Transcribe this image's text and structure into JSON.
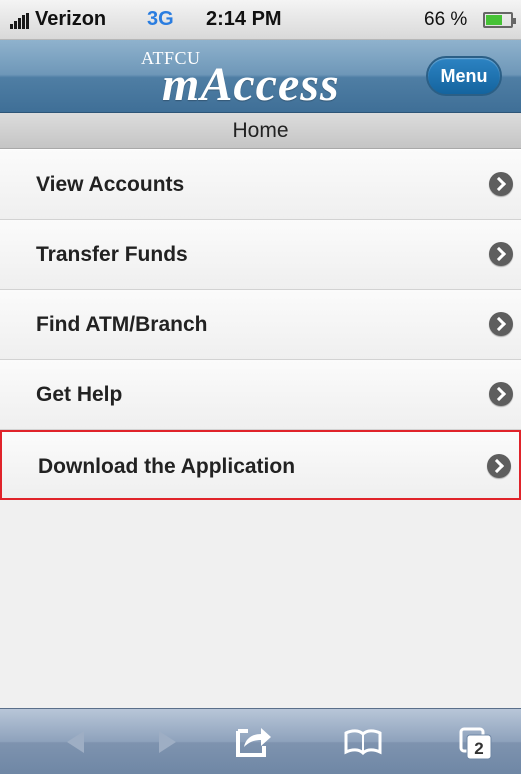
{
  "status_bar": {
    "carrier": "Verizon",
    "network": "3G",
    "time": "2:14 PM",
    "battery_percent": "66 %",
    "battery_level": 0.66
  },
  "header": {
    "logo_small": "ATFCU",
    "logo_large": "mAccess",
    "menu_label": "Menu"
  },
  "page_title": "Home",
  "menu_items": [
    {
      "label": "View Accounts"
    },
    {
      "label": "Transfer Funds"
    },
    {
      "label": "Find ATM/Branch"
    },
    {
      "label": "Get Help"
    },
    {
      "label": "Download the Application"
    }
  ],
  "toolbar": {
    "tab_count": "2"
  },
  "colors": {
    "header_blue": "#4f7ea4",
    "menu_button": "#14649f",
    "highlight_border": "#e0232a",
    "network_blue": "#2a7de0",
    "battery_green": "#46c236"
  },
  "icons": [
    "signal-icon",
    "battery-icon",
    "chevron-right-icon",
    "back-arrow-icon",
    "forward-arrow-icon",
    "share-icon",
    "bookmarks-icon",
    "tabs-icon"
  ]
}
